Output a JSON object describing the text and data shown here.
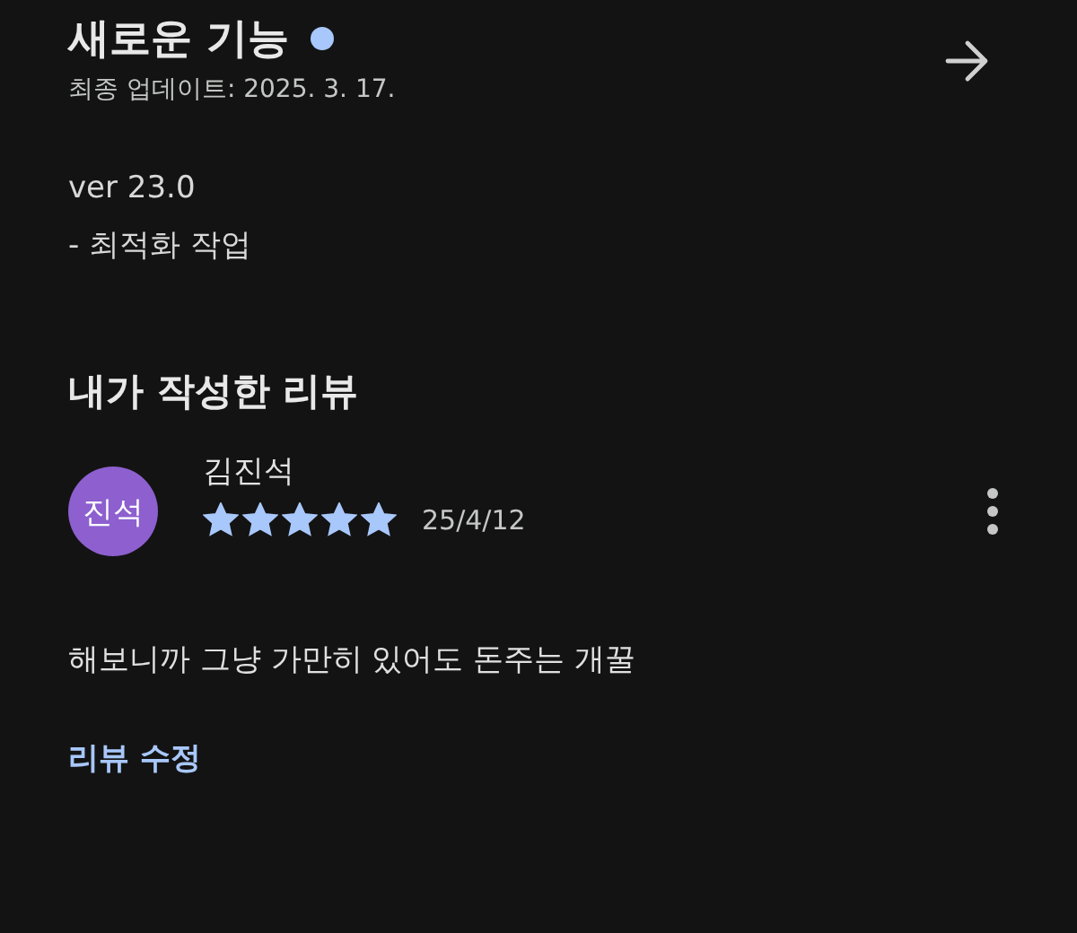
{
  "whats_new": {
    "title": "새로운 기능",
    "unread": true,
    "updated": "최종 업데이트: 2025. 3. 17.",
    "notes": [
      "ver 23.0",
      "- 최적화 작업"
    ]
  },
  "my_review": {
    "heading": "내가 작성한 리뷰",
    "avatar_initials": "진석",
    "author": "김진석",
    "stars": 5,
    "date": "25/4/12",
    "text": "해보니까 그냥 가만히 있어도 돈주는 개꿀",
    "edit_link": "리뷰 수정"
  }
}
